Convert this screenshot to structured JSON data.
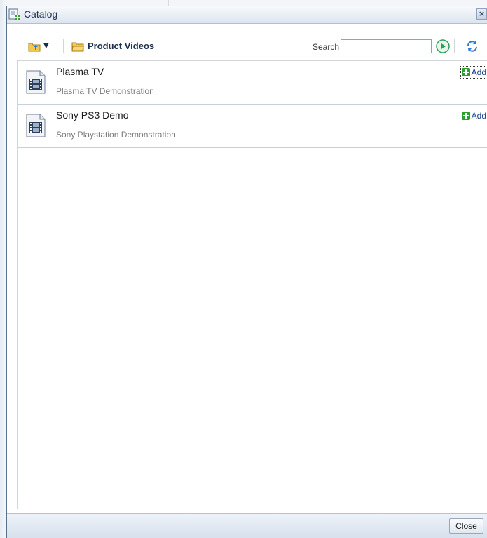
{
  "window": {
    "title": "Catalog",
    "close_glyph": "×"
  },
  "toolbar": {
    "caret_glyph": "▼",
    "path_label": "Product Videos",
    "search_label": "Search",
    "search_value": "",
    "home_icon": "folder-up-icon",
    "folder_icon": "folder-icon",
    "go_icon": "go-arrow-icon",
    "refresh_icon": "refresh-icon"
  },
  "items": [
    {
      "name": "Plasma TV",
      "description": "Plasma TV Demonstration",
      "add_label": "Add",
      "icon": "video-file-icon"
    },
    {
      "name": "Sony PS3 Demo",
      "description": "Sony Playstation Demonstration",
      "add_label": "Add",
      "icon": "video-file-icon"
    }
  ],
  "footer": {
    "close_label": "Close"
  },
  "colors": {
    "titlebar_border": "#5a6f8a",
    "link": "#1b3f8a",
    "add_green": "#2e9e2e",
    "go_green": "#2aa05a"
  }
}
